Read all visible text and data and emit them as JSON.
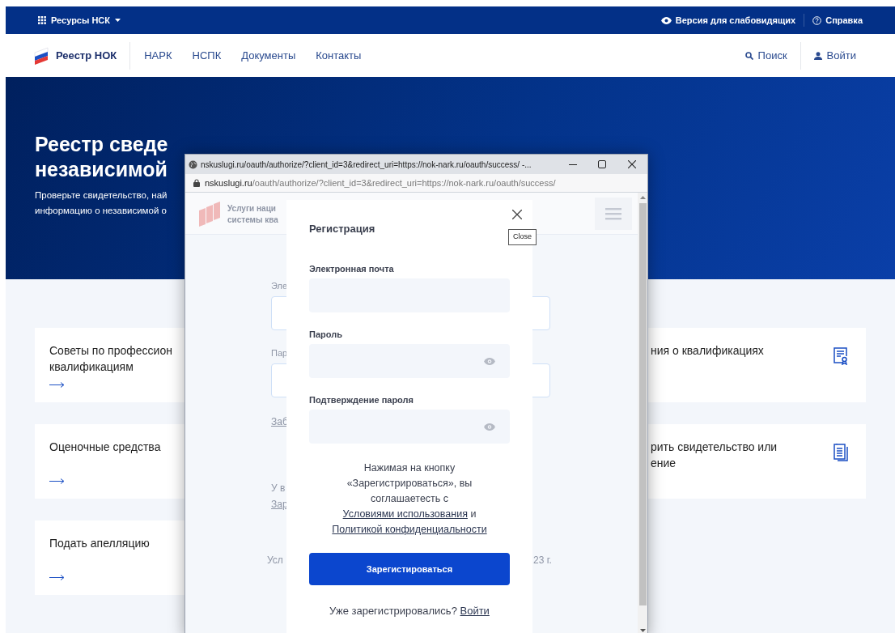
{
  "top_bar": {
    "resources_menu": "Ресурсы НСК",
    "accessibility_link": "Версия для слабовидящих",
    "help_link": "Справка"
  },
  "nav": {
    "logo_text": "Реестр НОК",
    "links": [
      "НАРК",
      "НСПК",
      "Документы",
      "Контакты"
    ],
    "search": "Поиск",
    "login": "Войти"
  },
  "hero": {
    "title_lines": [
      "Реестр сведе",
      "независимой"
    ],
    "subtitle_lines": [
      "Проверьте свидетельство, най",
      "информацию о независимой о"
    ]
  },
  "cards": [
    {
      "kind": "certificate",
      "left_lines": [
        "Советы по профессион",
        "квалификациям"
      ],
      "right_lines": [
        "ния о квалификациях"
      ]
    },
    {
      "kind": "document",
      "left_lines": [
        "Оценочные средства"
      ],
      "right_lines": [
        "рить свидетельство или",
        "ение"
      ]
    },
    {
      "kind": "single",
      "left_lines": [
        "Подать апелляцию"
      ]
    }
  ],
  "popup_window": {
    "title": "nskuslugi.ru/oauth/authorize/?client_id=3&redirect_uri=https://nok-nark.ru/oauth/success/ -...",
    "address_host": "nskuslugi.ru",
    "address_path": "/oauth/authorize/?client_id=3&redirect_uri=https://nok-nark.ru/oauth/success/",
    "background_page": {
      "header_lines": [
        "Услуги наци",
        "системы ква"
      ],
      "email_label": "Эле",
      "password_label": "Пар",
      "forgot_link": "Заб",
      "account_text": "У в",
      "register_link": "Зар",
      "footer_left": "Усл",
      "footer_right": "23 г."
    },
    "dialog": {
      "title": "Регистрация",
      "close_tooltip": "Close",
      "fields": [
        {
          "label": "Электронная почта",
          "kind": "text"
        },
        {
          "label": "Пароль",
          "kind": "password"
        },
        {
          "label": "Подтверждение пароля",
          "kind": "password"
        }
      ],
      "consent_text": "Нажимая на кнопку «Зарегистрироваться», вы соглашаетесть с",
      "terms_link": "Условиями использования",
      "conjunction": "и",
      "privacy_link": "Политикой конфиденциальности",
      "submit_button": "Зарегистироваться",
      "login_prompt": "Уже зарегистрировались?",
      "login_link": "Войти"
    }
  }
}
